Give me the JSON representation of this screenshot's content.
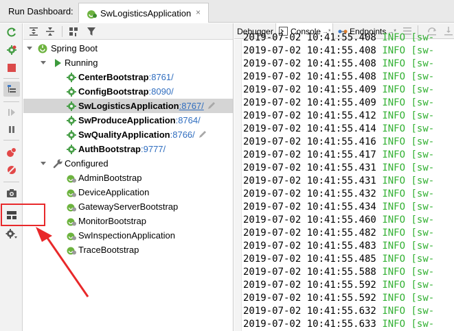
{
  "titlebar": {
    "label": "Run Dashboard:",
    "tab_label": "SwLogisticsApplication",
    "tab_close": "×"
  },
  "left_toolbar": {
    "icons": [
      "rerun-icon",
      "debug-gear-icon",
      "stop-icon",
      "group-tree-icon",
      "resume-icon",
      "pause-icon",
      "breakpoints-icon",
      "mute-breakpoints-icon",
      "camera-icon",
      "layout-icon",
      "settings-icon"
    ]
  },
  "tree": {
    "root": {
      "label": "Spring Boot"
    },
    "running": {
      "label": "Running",
      "apps": [
        {
          "name": "CenterBootstrap",
          "port": ":8761/",
          "selected": false,
          "underline": false,
          "pencil": false
        },
        {
          "name": "ConfigBootstrap",
          "port": ":8090/",
          "selected": false,
          "underline": false,
          "pencil": false
        },
        {
          "name": "SwLogisticsApplication",
          "port": ":8767/",
          "selected": true,
          "underline": true,
          "pencil": true
        },
        {
          "name": "SwProduceApplication",
          "port": ":8764/",
          "selected": false,
          "underline": false,
          "pencil": false
        },
        {
          "name": "SwQualityApplication",
          "port": ":8766/",
          "selected": false,
          "underline": false,
          "pencil": true
        },
        {
          "name": "AuthBootstrap",
          "port": ":9777/",
          "selected": false,
          "underline": false,
          "pencil": false
        }
      ]
    },
    "configured": {
      "label": "Configured",
      "apps": [
        "AdminBootstrap",
        "DeviceApplication",
        "GatewayServerBootstrap",
        "MonitorBootstrap",
        "SwInspectionApplication",
        "TraceBootstrap"
      ]
    }
  },
  "console": {
    "tabs": [
      {
        "label": "Debugger",
        "pin": ""
      },
      {
        "label": "Console",
        "pin": "→*"
      },
      {
        "label": "Endpoints",
        "pin": "→*"
      }
    ],
    "lines": [
      {
        "ts": "2019-07-02 10:41:55.408",
        "lvl": "INFO",
        "src": "[sw-"
      },
      {
        "ts": "2019-07-02 10:41:55.408",
        "lvl": "INFO",
        "src": "[sw-"
      },
      {
        "ts": "2019-07-02 10:41:55.408",
        "lvl": "INFO",
        "src": "[sw-"
      },
      {
        "ts": "2019-07-02 10:41:55.408",
        "lvl": "INFO",
        "src": "[sw-"
      },
      {
        "ts": "2019-07-02 10:41:55.409",
        "lvl": "INFO",
        "src": "[sw-"
      },
      {
        "ts": "2019-07-02 10:41:55.409",
        "lvl": "INFO",
        "src": "[sw-"
      },
      {
        "ts": "2019-07-02 10:41:55.412",
        "lvl": "INFO",
        "src": "[sw-"
      },
      {
        "ts": "2019-07-02 10:41:55.414",
        "lvl": "INFO",
        "src": "[sw-"
      },
      {
        "ts": "2019-07-02 10:41:55.416",
        "lvl": "INFO",
        "src": "[sw-"
      },
      {
        "ts": "2019-07-02 10:41:55.417",
        "lvl": "INFO",
        "src": "[sw-"
      },
      {
        "ts": "2019-07-02 10:41:55.431",
        "lvl": "INFO",
        "src": "[sw-"
      },
      {
        "ts": "2019-07-02 10:41:55.431",
        "lvl": "INFO",
        "src": "[sw-"
      },
      {
        "ts": "2019-07-02 10:41:55.432",
        "lvl": "INFO",
        "src": "[sw-"
      },
      {
        "ts": "2019-07-02 10:41:55.434",
        "lvl": "INFO",
        "src": "[sw-"
      },
      {
        "ts": "2019-07-02 10:41:55.460",
        "lvl": "INFO",
        "src": "[sw-"
      },
      {
        "ts": "2019-07-02 10:41:55.482",
        "lvl": "INFO",
        "src": "[sw-"
      },
      {
        "ts": "2019-07-02 10:41:55.483",
        "lvl": "INFO",
        "src": "[sw-"
      },
      {
        "ts": "2019-07-02 10:41:55.485",
        "lvl": "INFO",
        "src": "[sw-"
      },
      {
        "ts": "2019-07-02 10:41:55.588",
        "lvl": "INFO",
        "src": "[sw-"
      },
      {
        "ts": "2019-07-02 10:41:55.592",
        "lvl": "INFO",
        "src": "[sw-"
      },
      {
        "ts": "2019-07-02 10:41:55.592",
        "lvl": "INFO",
        "src": "[sw-"
      },
      {
        "ts": "2019-07-02 10:41:55.632",
        "lvl": "INFO",
        "src": "[sw-"
      },
      {
        "ts": "2019-07-02 10:41:55.633",
        "lvl": "INFO",
        "src": "[sw-"
      }
    ]
  },
  "colors": {
    "port_blue": "#2f6dbf",
    "log_info_green": "#32b032",
    "annotation_red": "#e8282a",
    "spring_green": "#5fb832"
  }
}
